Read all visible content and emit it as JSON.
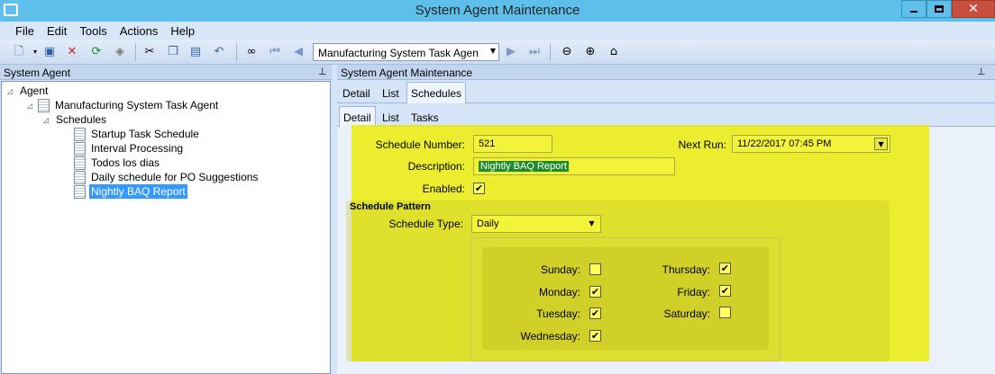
{
  "window": {
    "title": "System Agent Maintenance",
    "close_glyph": "✕"
  },
  "menu": [
    "File",
    "Edit",
    "Tools",
    "Actions",
    "Help"
  ],
  "toolbar": {
    "agent_select": "Manufacturing System Task Agen",
    "icons": [
      "new-icon",
      "save-icon",
      "delete-icon",
      "refresh-icon",
      "clear-icon",
      "cut-icon",
      "copy-icon",
      "undo-icon",
      "binoculars-icon",
      "first-icon",
      "prev-icon",
      "next-icon",
      "last-icon",
      "back-icon",
      "forward-icon",
      "home-icon"
    ]
  },
  "left_pane": {
    "title": "System Agent",
    "tree": {
      "root": "Agent",
      "agent": "Manufacturing System Task Agent",
      "schedules": "Schedules",
      "items": [
        "Startup Task Schedule",
        "Interval Processing",
        "Todos los dias",
        "Daily schedule for PO Suggestions",
        "Nightly BAQ Report"
      ]
    }
  },
  "right_pane": {
    "title": "System Agent Maintenance",
    "tabs": [
      "Detail",
      "List",
      "Schedules"
    ],
    "subtabs": [
      "Detail",
      "List",
      "Tasks"
    ]
  },
  "form": {
    "schedule_number_label": "Schedule Number:",
    "schedule_number": "521",
    "next_run_label": "Next Run:",
    "next_run": "11/22/2017 07:45 PM",
    "description_label": "Description:",
    "description": "Nightly BAQ Report",
    "enabled_label": "Enabled:",
    "enabled_check": "✔",
    "pattern_title": "Schedule Pattern",
    "schedule_type_label": "Schedule Type:",
    "schedule_type": "Daily",
    "days": {
      "sunday": {
        "label": "Sunday:",
        "check": ""
      },
      "monday": {
        "label": "Monday:",
        "check": "✔"
      },
      "tuesday": {
        "label": "Tuesday:",
        "check": "✔"
      },
      "wednesday": {
        "label": "Wednesday:",
        "check": "✔"
      },
      "thursday": {
        "label": "Thursday:",
        "check": "✔"
      },
      "friday": {
        "label": "Friday:",
        "check": "✔"
      },
      "saturday": {
        "label": "Saturday:",
        "check": ""
      }
    }
  },
  "colors": {
    "highlight": "#ecec00",
    "selection": "#3399ff",
    "titlebar": "#5ec0ea"
  }
}
